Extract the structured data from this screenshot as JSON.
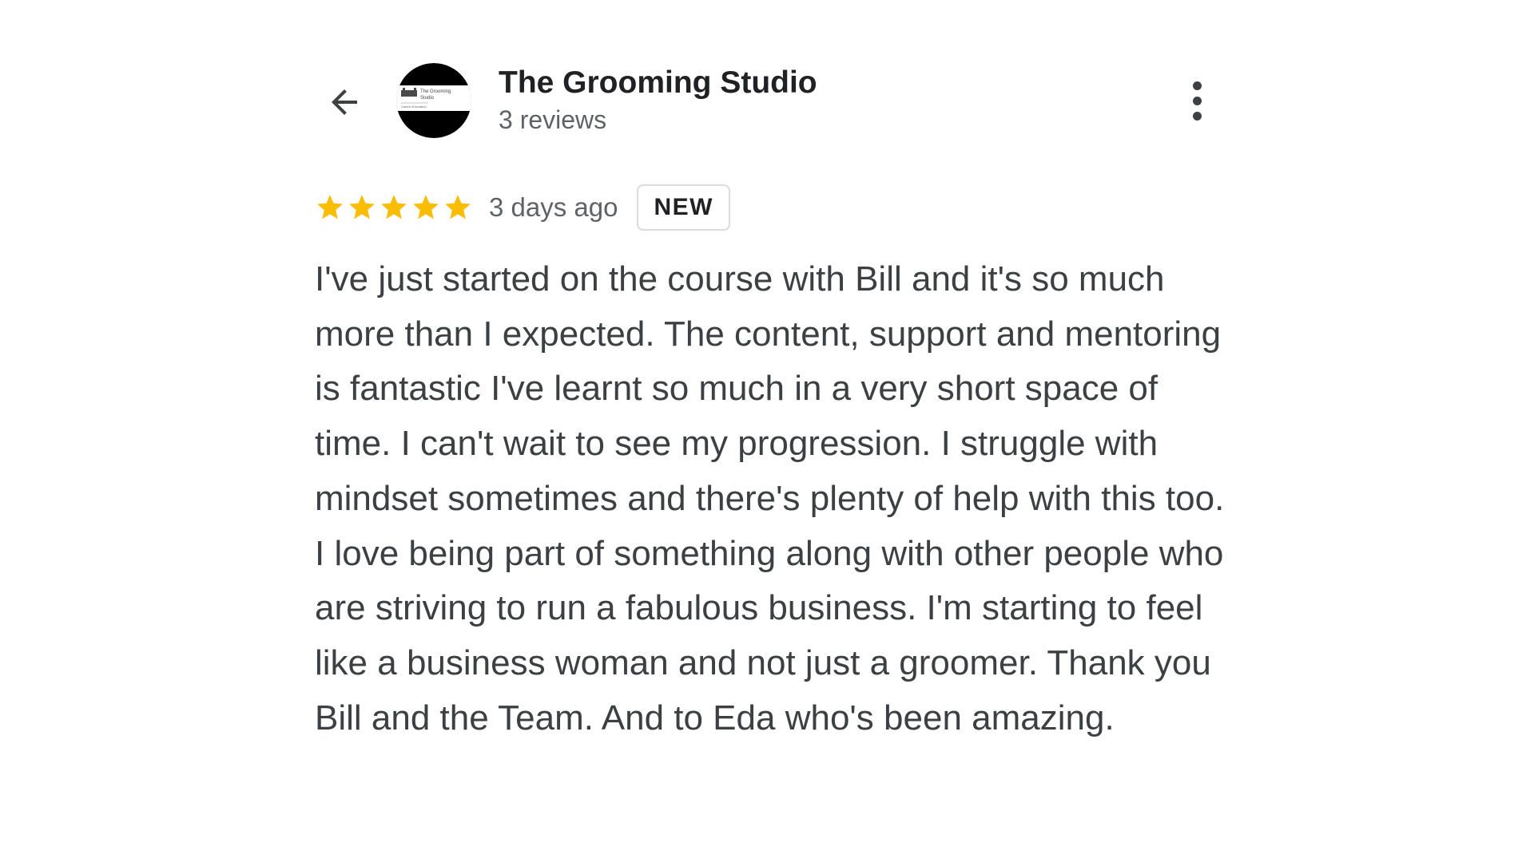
{
  "header": {
    "back_icon": "arrow-left-icon",
    "avatar": {
      "logo_text_line1": "The Grooming",
      "logo_text_line2": "Studio",
      "logo_caption": "Canine Education",
      "colors": {
        "top": "#000000",
        "band": "#ffffff",
        "bottom": "#000000"
      }
    },
    "business_name": "The Grooming Studio",
    "review_count": "3 reviews",
    "more_icon": "more-vertical-icon"
  },
  "review": {
    "rating": 5,
    "rating_max": 5,
    "star_color": "#fbbc04",
    "date": "3 days ago",
    "badge": "NEW",
    "text": "I've just started on the course with Bill and it's so much more than I expected. The content, support and mentoring is fantastic I've learnt so much in a very short space of time. I can't wait to see my progression. I struggle with mindset sometimes and there's plenty of help with this too. I love being part of something along with other people who are striving to run a fabulous business. I'm starting to feel like a business woman and not just a groomer. Thank you Bill and the Team. And to Eda who's been amazing."
  }
}
